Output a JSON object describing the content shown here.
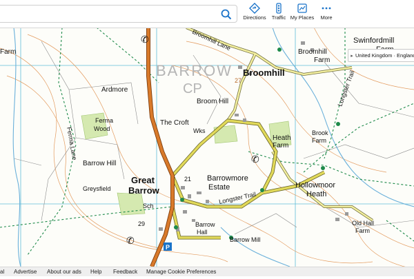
{
  "search": {
    "value": "",
    "placeholder": ""
  },
  "toolbar": {
    "directions_label": "Directions",
    "traffic_label": "Traffic",
    "myplaces_label": "My Places",
    "more_label": "More"
  },
  "region_chip": {
    "label": "United Kingdom · England"
  },
  "map": {
    "place_labels": {
      "swinfordmill": "Swinfordmill",
      "swinfordmill_farm": "Farm",
      "barrow": "BARROW",
      "cp": "CP",
      "broomhill": "Broomhill",
      "broomhill_lane": "Broomhill Lane",
      "broomhill_farm": "Broomhill",
      "broomhill_farm2": "Farm",
      "broom_hill": "Broom Hill",
      "longster_trail_ne": "Longster Trail",
      "ardmore": "Ardmore",
      "ferma_wood1": "Ferma",
      "ferma_wood2": "Wood",
      "ferma_lane": "Ferma Lane",
      "the_croft": "The Croft",
      "wks": "Wks",
      "brook_farm1": "Brook",
      "brook_farm2": "Farm",
      "heath_farm1": "Heath",
      "heath_farm2": "Farm",
      "barrow_hill": "Barrow Hill",
      "great": "Great",
      "barrow2": "Barrow",
      "barrowmore": "Barrowmore",
      "estate": "Estate",
      "hollowmoor": "Hollowmoor",
      "heath": "Heath",
      "greysfield": "Greysfield",
      "sch": "Sch",
      "longster_trail_s": "Longster Trail",
      "barrow_hall1": "Barrow",
      "barrow_hall2": "Hall",
      "barrow_mill": "Barrow Mill",
      "old_hall_farm1": "Old Hall",
      "old_hall_farm2": "Farm",
      "farm_left": "Farm",
      "road_21": "21",
      "road_29": "29",
      "road_27": "27"
    }
  },
  "footer": {
    "links": [
      "al",
      "Advertise",
      "About our ads",
      "Help",
      "Feedback",
      "Manage Cookie Preferences"
    ]
  },
  "colors": {
    "contour": "#e39a5d",
    "a_road": "#d97a2a",
    "b_road": "#e1d95a",
    "minor_road": "#f4f0a0",
    "footpath": "#1e8a4a",
    "stream": "#6ab0da",
    "grid": "#5fbcd8",
    "field": "#8a8a8a",
    "woodland": "#d5e9b0",
    "accent": "#1a73c9"
  }
}
